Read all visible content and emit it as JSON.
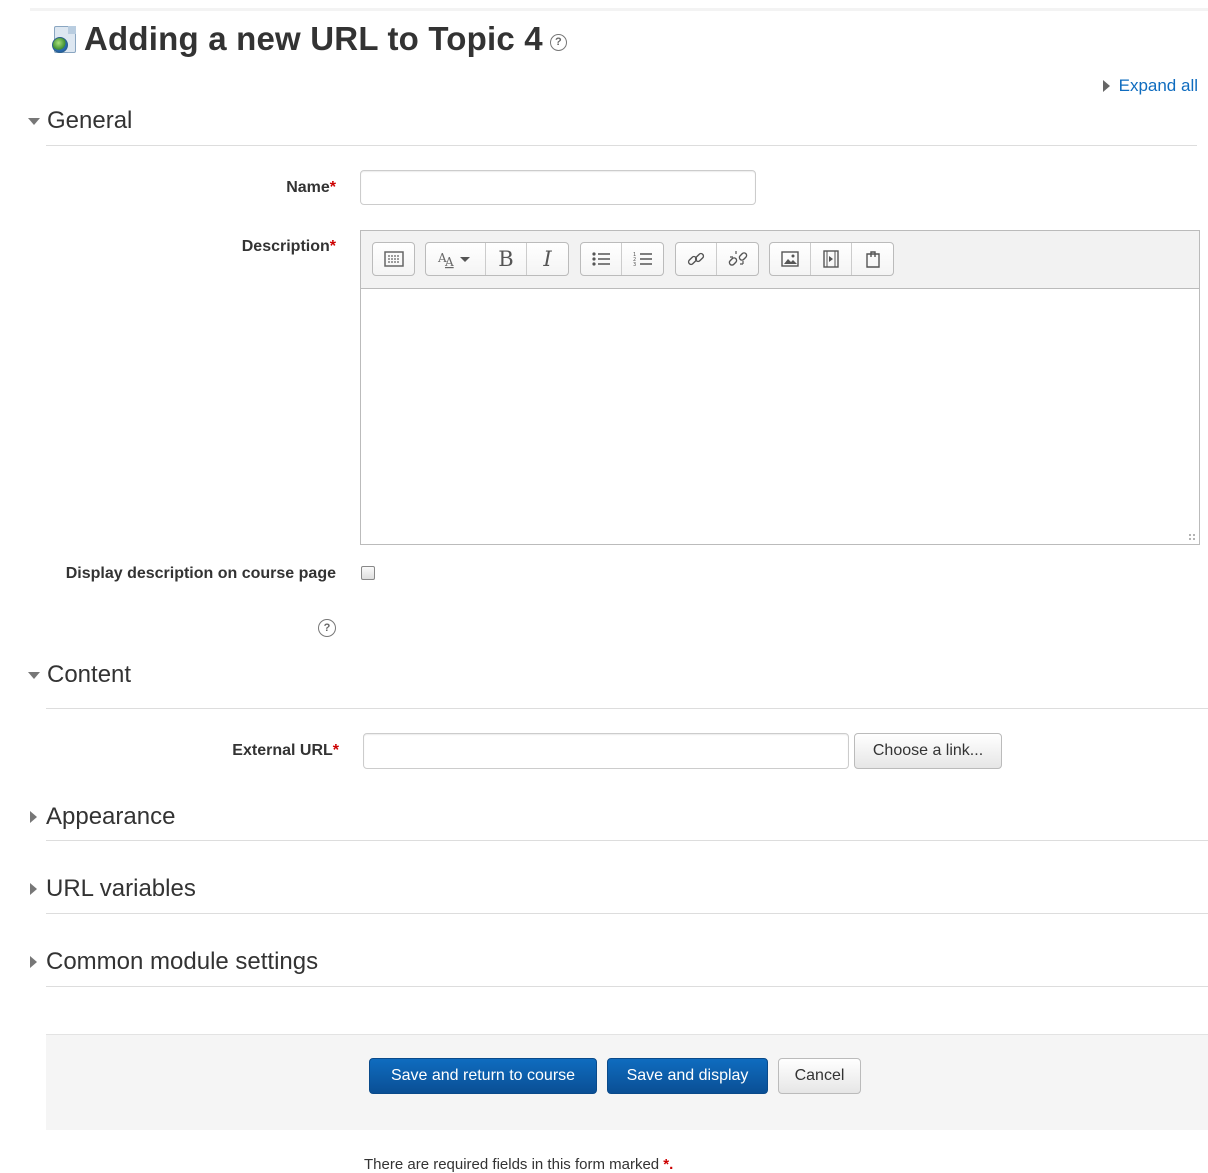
{
  "page": {
    "title": "Adding a new URL to Topic 4",
    "help_glyph": "?",
    "expand_all": "Expand all"
  },
  "sections": {
    "general": "General",
    "content": "Content",
    "appearance": "Appearance",
    "url_variables": "URL variables",
    "common_module_settings": "Common module settings"
  },
  "fields": {
    "name": {
      "label": "Name",
      "value": "",
      "required_mark": "*"
    },
    "description": {
      "label": "Description",
      "required_mark": "*",
      "value": ""
    },
    "display_description": {
      "label": "Display description on course page",
      "checked": false
    },
    "external_url": {
      "label": "External URL",
      "value": "",
      "required_mark": "*"
    },
    "choose_link": "Choose a link..."
  },
  "toolbar": {
    "icons": [
      "toolbar-toggle-icon",
      "font-size-icon",
      "bold-icon",
      "italic-icon",
      "unordered-list-icon",
      "ordered-list-icon",
      "link-icon",
      "unlink-icon",
      "image-icon",
      "media-icon",
      "manage-files-icon"
    ],
    "bold": "B",
    "italic": "I"
  },
  "buttons": {
    "save_return": "Save and return to course",
    "save_display": "Save and display",
    "cancel": "Cancel"
  },
  "footer": {
    "required_note": "There are required fields in this form marked",
    "required_mark": "*."
  },
  "colors": {
    "primary": "#0f6cbf",
    "required": "#cc0000",
    "link": "#0f6cbf"
  }
}
